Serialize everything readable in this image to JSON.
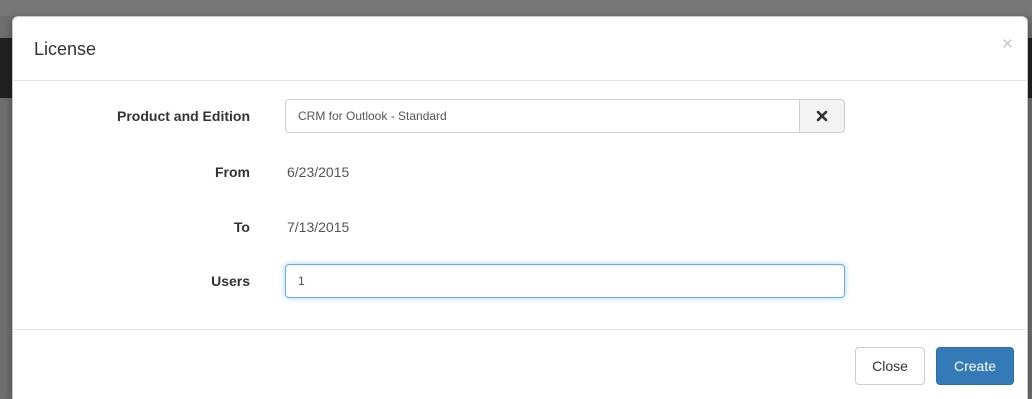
{
  "modal": {
    "title": "License",
    "close_icon_glyph": "×"
  },
  "form": {
    "product": {
      "label": "Product and Edition",
      "value": "CRM for Outlook - Standard",
      "clear_icon": "times-icon"
    },
    "from": {
      "label": "From",
      "value": "6/23/2015"
    },
    "to": {
      "label": "To",
      "value": "7/13/2015"
    },
    "users": {
      "label": "Users",
      "value": "1"
    }
  },
  "footer": {
    "close_label": "Close",
    "create_label": "Create"
  },
  "colors": {
    "primary": "#337ab7",
    "focus_border": "#66afe9",
    "backdrop": "#6f6f6f"
  }
}
